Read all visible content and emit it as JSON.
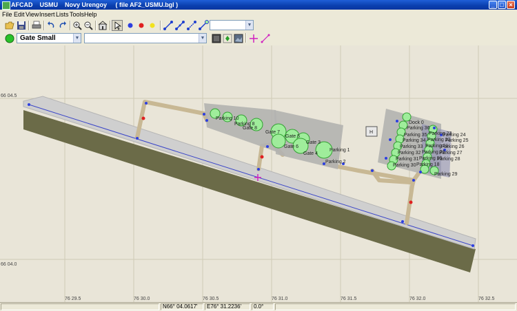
{
  "window": {
    "title": "AFCAD    USMU    Novy Urengoy     ( file AF2_USMU.bgl )",
    "minimize_glyph": "_",
    "maximize_glyph": "□",
    "close_glyph": "×"
  },
  "menu": [
    "File",
    "Edit",
    "View",
    "Insert",
    "Lists",
    "Tools",
    "Help"
  ],
  "toolbar": {
    "top_select_value": "",
    "object_type": "Gate Small",
    "object_name": ""
  },
  "map": {
    "lat_labels": [
      "66 04.5",
      "66 04.0"
    ],
    "lon_labels": [
      "76 29.5",
      "76 30.0",
      "76 30.5",
      "76 31.0",
      "76 31.5",
      "76 32.0",
      "76 32.5"
    ],
    "left_apron_labels": [
      "Parking 10",
      "Parking 8",
      "Gate 8",
      "Gate 7",
      "Gate 5",
      "Gate 6",
      "Gate 3",
      "Gate 4",
      "Parking 1",
      "Parking 2"
    ],
    "right_apron_labels": [
      "Dock 0",
      "Parking 36",
      "Parking 35",
      "Parking 34",
      "Parking 33",
      "Parking 32",
      "Parking 31",
      "Parking 30",
      "Parking 23",
      "Parking 22",
      "Parking 24",
      "Parking 25",
      "Parking 21",
      "Parking 26",
      "Parking 20",
      "Parking 27",
      "Parking 19",
      "Parking 28",
      "Parking 18",
      "Parking 29"
    ],
    "helipad_label": "H"
  },
  "status": {
    "cell1": "",
    "cell2": "",
    "latitude": "N66° 04.0617'",
    "longitude": "E76° 31.2236'",
    "heading": "0.0°"
  },
  "colors": {
    "titlebar": "#0a3fae",
    "runway_ground": "#6b6b48",
    "runway_surface": "#c8c8c8",
    "taxiway": "#c8b894",
    "apron": "#b3b3b0",
    "parking_circle": "#9ef09a",
    "node_blue": "#2d3fe0",
    "node_red": "#e02020"
  }
}
